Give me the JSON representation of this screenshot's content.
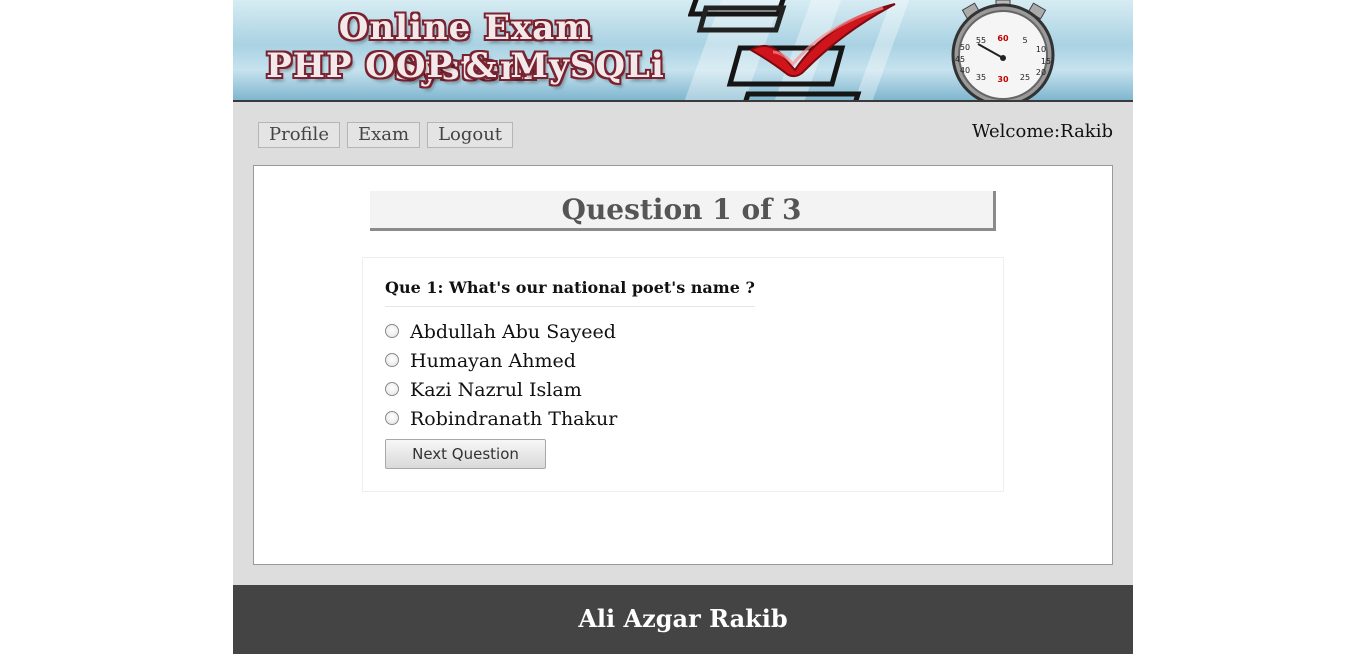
{
  "banner": {
    "title_line1": "Online Exam System",
    "title_line2": "PHP OOP & MySQLi"
  },
  "nav": {
    "items": [
      {
        "label": "Profile"
      },
      {
        "label": "Exam"
      },
      {
        "label": "Logout"
      }
    ]
  },
  "welcome": {
    "label": "Welcome:",
    "user": "Rakib"
  },
  "question": {
    "header_word": "Question",
    "current": "1",
    "of_word": "of",
    "total": "3",
    "prefix": "Que 1:",
    "text": "What's our national poet's name ?",
    "options": [
      {
        "label": "Abdullah Abu Sayeed"
      },
      {
        "label": "Humayan Ahmed"
      },
      {
        "label": "Kazi Nazrul Islam"
      },
      {
        "label": "Robindranath Thakur"
      }
    ],
    "next_label": "Next Question"
  },
  "footer": {
    "text": "Ali Azgar Rakib"
  },
  "colors": {
    "title_outline": "#7a2230",
    "checkmark": "#d0141c",
    "footer_bg": "#444444"
  },
  "icons": {
    "checkmark": "checkmark-icon",
    "clock": "stopwatch-icon",
    "checklist": "checklist-icon"
  }
}
